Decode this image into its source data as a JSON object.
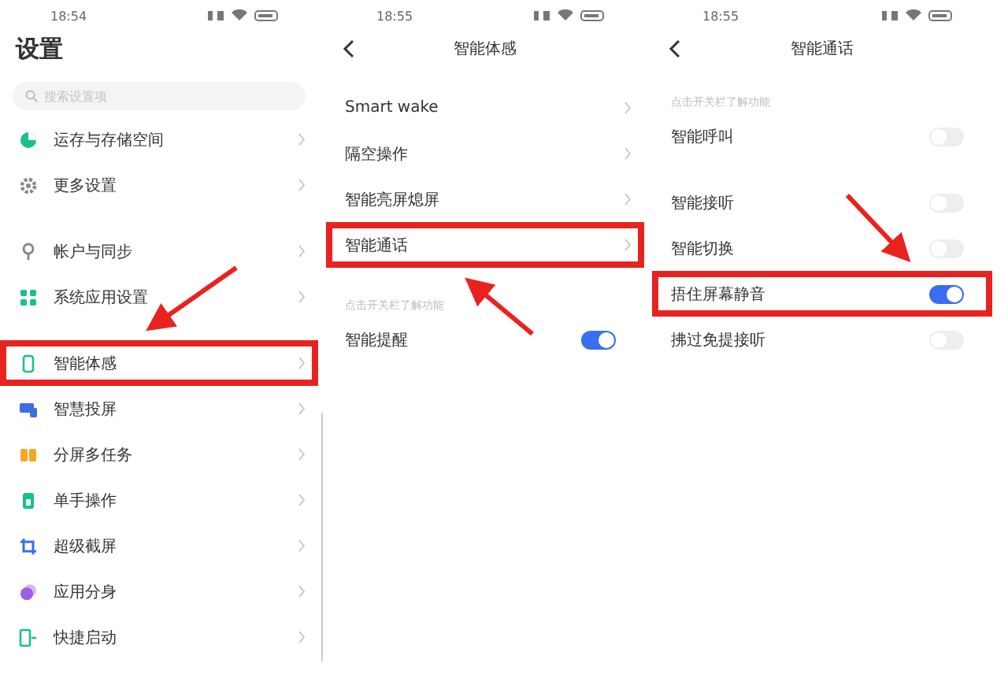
{
  "panels": [
    {
      "time": "18:54",
      "title": "设置",
      "kind": "main",
      "search": {
        "placeholder": "搜索设置项"
      },
      "sections": [
        {
          "items": [
            {
              "label": "运存与存储空间",
              "kind": "link",
              "highlighted": false
            },
            {
              "label": "更多设置",
              "kind": "link",
              "highlighted": false
            }
          ]
        },
        {
          "items": [
            {
              "label": "帐户与同步",
              "kind": "link",
              "highlighted": false
            },
            {
              "label": "系统应用设置",
              "kind": "link",
              "highlighted": false
            }
          ]
        },
        {
          "items": [
            {
              "label": "智能体感",
              "kind": "link",
              "highlighted": true
            },
            {
              "label": "智慧投屏",
              "kind": "link",
              "highlighted": false
            },
            {
              "label": "分屏多任务",
              "kind": "link",
              "highlighted": false
            },
            {
              "label": "单手操作",
              "kind": "link",
              "highlighted": false
            },
            {
              "label": "超级截屏",
              "kind": "link",
              "highlighted": false
            },
            {
              "label": "应用分身",
              "kind": "link",
              "highlighted": false
            },
            {
              "label": "快捷启动",
              "kind": "link",
              "highlighted": false
            }
          ]
        }
      ]
    },
    {
      "time": "18:55",
      "title": "智能体感",
      "kind": "sub",
      "sections": [
        {
          "items": [
            {
              "label": "Smart wake",
              "kind": "link",
              "highlighted": false
            },
            {
              "label": "隔空操作",
              "kind": "link",
              "highlighted": false
            },
            {
              "label": "智能亮屏熄屏",
              "kind": "link",
              "highlighted": false
            },
            {
              "label": "智能通话",
              "kind": "link",
              "highlighted": true
            }
          ]
        },
        {
          "hint": "点击开关栏了解功能",
          "items": [
            {
              "label": "智能提醒",
              "kind": "toggle",
              "on": true,
              "highlighted": false
            }
          ]
        }
      ]
    },
    {
      "time": "18:55",
      "title": "智能通话",
      "kind": "sub",
      "sections": [
        {
          "hint": "点击开关栏了解功能",
          "items": [
            {
              "label": "智能呼叫",
              "kind": "toggle",
              "on": false,
              "highlighted": false
            }
          ]
        },
        {
          "items": [
            {
              "label": "智能接听",
              "kind": "toggle",
              "on": false,
              "highlighted": false
            },
            {
              "label": "智能切换",
              "kind": "toggle",
              "on": false,
              "highlighted": false
            },
            {
              "label": "捂住屏幕静音",
              "kind": "toggle",
              "on": true,
              "highlighted": true
            },
            {
              "label": "拂过免提接听",
              "kind": "toggle",
              "on": false,
              "highlighted": false
            }
          ]
        }
      ]
    }
  ]
}
